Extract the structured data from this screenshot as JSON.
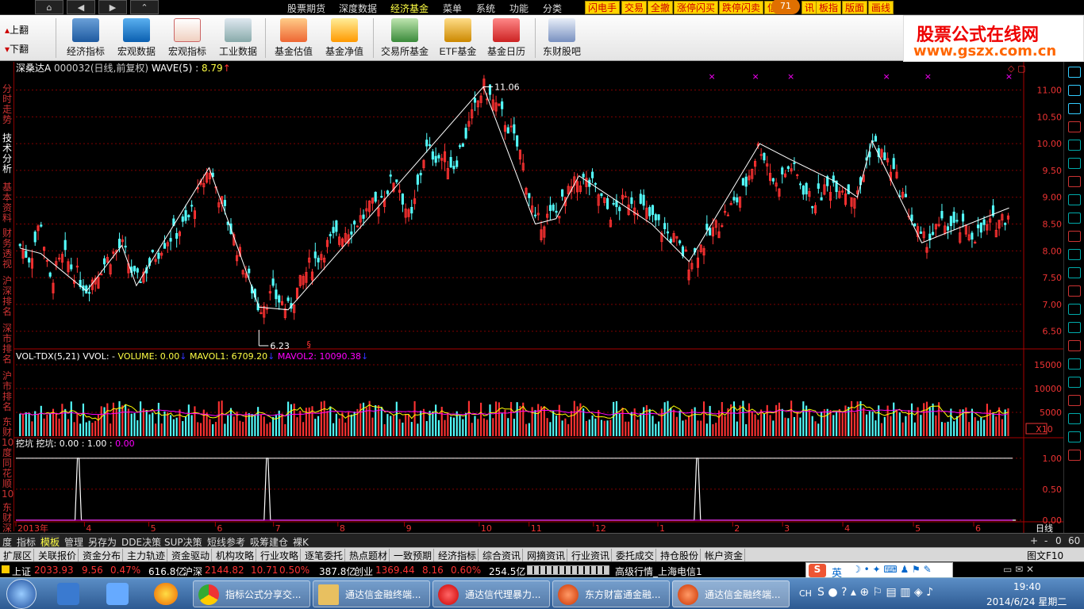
{
  "menubar": {
    "items": [
      "股票期货",
      "深度数据",
      "经济基金",
      "菜单",
      "系统",
      "功能",
      "分类"
    ],
    "active_index": 2,
    "quick": [
      "闪电手",
      "交易",
      "全撤",
      "涨停闪买",
      "跌停闪卖",
      "信",
      "讯",
      "板指",
      "版面",
      "画线"
    ],
    "badge": "71"
  },
  "toolbar": {
    "pageup": "上翻",
    "pagedown": "下翻",
    "items": [
      "经济指标",
      "宏观数据",
      "宏观指标",
      "工业数据",
      "基金估值",
      "基金净值",
      "交易所基金",
      "ETF基金",
      "基金日历",
      "东财股吧"
    ]
  },
  "logo": {
    "line1": "股票公式在线网",
    "line2": "www.gszx.com.cn"
  },
  "leftbar": {
    "tabs": [
      "分时走势",
      "技术分析",
      "基本资料",
      "财务透视",
      "沪深排名",
      "深市排名",
      "沪市排名",
      "东财10度",
      "同花顺10",
      "东财深度"
    ]
  },
  "price_panel": {
    "title": "深桑达A",
    "code": "000032(日线,前复权)",
    "indicator": "WAVE(5) :",
    "indicator_value": "8.79",
    "high_label": "11.06",
    "low_label": "6.23",
    "y_ticks": [
      "11.00",
      "10.50",
      "10.00",
      "9.50",
      "9.00",
      "8.50",
      "8.00",
      "7.50",
      "7.00",
      "6.50"
    ],
    "marker": "§"
  },
  "volume_panel": {
    "title": "VOL-TDX(5,21)",
    "vvol": "VVOL: -",
    "volume": "VOLUME: 0.00",
    "mavol1": "MAVOL1: 6709.20",
    "mavol2": "MAVOL2: 10090.38",
    "y_ticks": [
      "15000",
      "10000",
      "5000"
    ],
    "unit": "X10"
  },
  "wakeng_panel": {
    "title": "挖坑",
    "values": "挖坑: 0.00 : 1.00 :",
    "extra": "0.00",
    "y_ticks": [
      "1.00",
      "0.50",
      "0.00"
    ]
  },
  "time_axis": {
    "labels": [
      "2013年",
      "4",
      "5",
      "6",
      "7",
      "8",
      "9",
      "10",
      "11",
      "12",
      "1",
      "2",
      "3",
      "4",
      "5",
      "6"
    ],
    "period": "日线"
  },
  "tabs1": {
    "items": [
      "度",
      "指标",
      "模板",
      "管理",
      "另存为",
      "DDE决策",
      "SUP决策",
      "短线参考",
      "吸筹建仓",
      "裸K"
    ],
    "right": [
      "+",
      "-",
      "0",
      "60"
    ]
  },
  "tabs2": {
    "items": [
      "扩展区",
      "关联报价",
      "资金分布",
      "主力轨迹",
      "资金驱动",
      "机构攻略",
      "行业攻略",
      "逐笔委托",
      "热点题材",
      "一致预期",
      "经济指标",
      "综合资讯",
      "网摘资讯",
      "行业资讯",
      "委托成交",
      "持仓股份",
      "帐户资金"
    ],
    "right": "图文F10"
  },
  "status": {
    "sh_label": "上证",
    "sh_value": "2033.93",
    "sh_chg": "9.56",
    "sh_pct": "0.47%",
    "sh_amt": "616.8亿",
    "hs_label": "沪深",
    "hs_value": "2144.82",
    "hs_chg": "10.71",
    "hs_pct": "0.50%",
    "hs_amt": "387.8亿",
    "cy_label": "创业",
    "cy_value": "1369.44",
    "cy_chg": "8.16",
    "cy_pct": "0.60%",
    "cy_amt": "254.5亿",
    "feed": "高级行情_上海电信1",
    "ime": "英"
  },
  "taskbar": {
    "tasks": [
      "指标公式分享交...",
      "通达信金融终端...",
      "通达信代理暴力...",
      "东方财富通金融...",
      "通达信金融终端..."
    ],
    "lang": "CH",
    "time": "19:40",
    "date": "2014/6/24 星期二"
  },
  "colors": {
    "up": "#ff3232",
    "down": "#54ffff",
    "wave": "#ffffff",
    "ma1": "#ffff00",
    "ma2": "#ff00ff",
    "grid": "#800000"
  },
  "chart_data": {
    "type": "candlestick",
    "ohlc_close_path": [
      [
        "2013-03-01",
        8.1
      ],
      [
        "2013-03-06",
        7.85
      ],
      [
        "2013-03-11",
        8.6
      ],
      [
        "2013-03-15",
        7.4
      ],
      [
        "2013-03-22",
        7.9
      ],
      [
        "2013-04-02",
        7.3
      ],
      [
        "2013-04-10",
        7.75
      ],
      [
        "2013-04-19",
        8.1
      ],
      [
        "2013-04-26",
        7.4
      ],
      [
        "2013-05-10",
        8.2
      ],
      [
        "2013-05-20",
        8.5
      ],
      [
        "2013-05-31",
        9.55
      ],
      [
        "2013-06-06",
        8.9
      ],
      [
        "2013-06-14",
        8.0
      ],
      [
        "2013-06-24",
        6.95
      ],
      [
        "2013-07-01",
        7.2
      ],
      [
        "2013-07-08",
        6.9
      ],
      [
        "2013-07-18",
        7.7
      ],
      [
        "2013-07-29",
        8.2
      ],
      [
        "2013-08-09",
        8.5
      ],
      [
        "2013-08-20",
        8.9
      ],
      [
        "2013-08-29",
        9.4
      ],
      [
        "2013-09-05",
        8.5
      ],
      [
        "2013-09-12",
        9.9
      ],
      [
        "2013-09-26",
        9.6
      ],
      [
        "2013-10-10",
        11.06
      ],
      [
        "2013-10-21",
        10.4
      ],
      [
        "2013-10-28",
        9.8
      ],
      [
        "2013-11-04",
        8.5
      ],
      [
        "2013-11-14",
        8.7
      ],
      [
        "2013-11-25",
        9.35
      ],
      [
        "2013-12-02",
        9.2
      ],
      [
        "2013-12-10",
        8.7
      ],
      [
        "2013-12-20",
        9.0
      ],
      [
        "2013-12-30",
        8.6
      ],
      [
        "2014-01-10",
        8.2
      ],
      [
        "2014-01-17",
        7.8
      ],
      [
        "2014-01-27",
        8.3
      ],
      [
        "2014-02-12",
        9.1
      ],
      [
        "2014-02-20",
        10.0
      ],
      [
        "2014-02-28",
        9.2
      ],
      [
        "2014-03-07",
        9.6
      ],
      [
        "2014-03-17",
        8.9
      ],
      [
        "2014-03-28",
        9.3
      ],
      [
        "2014-04-08",
        9.0
      ],
      [
        "2014-04-15",
        10.05
      ],
      [
        "2014-04-25",
        9.5
      ],
      [
        "2014-05-09",
        8.15
      ],
      [
        "2014-05-20",
        8.5
      ],
      [
        "2014-06-04",
        8.3
      ],
      [
        "2014-06-20",
        8.7
      ]
    ],
    "high": 11.06,
    "low": 6.23,
    "ylim": [
      6.2,
      11.2
    ],
    "wave_pivots": [
      [
        "2013-03-01",
        8.05
      ],
      [
        "2013-03-11",
        7.95
      ],
      [
        "2013-04-02",
        7.25
      ],
      [
        "2013-04-19",
        8.1
      ],
      [
        "2013-04-26",
        7.35
      ],
      [
        "2013-05-31",
        9.55
      ],
      [
        "2013-06-24",
        6.95
      ],
      [
        "2013-07-08",
        6.9
      ],
      [
        "2013-10-10",
        11.06
      ],
      [
        "2013-11-04",
        8.5
      ],
      [
        "2013-11-14",
        8.6
      ],
      [
        "2013-11-25",
        9.4
      ],
      [
        "2013-12-30",
        8.5
      ],
      [
        "2014-01-17",
        7.8
      ],
      [
        "2014-02-20",
        10.0
      ],
      [
        "2014-03-07",
        9.7
      ],
      [
        "2014-03-28",
        9.3
      ],
      [
        "2014-04-08",
        9.0
      ],
      [
        "2014-04-15",
        10.05
      ],
      [
        "2014-05-09",
        8.15
      ],
      [
        "2014-06-20",
        8.8
      ]
    ],
    "volume_ylim": [
      0,
      17000
    ],
    "wakeng_signals": [
      "2013-03-29",
      "2013-06-28",
      "2014-01-21"
    ],
    "wakeng_ylim": [
      0,
      1.1
    ]
  }
}
